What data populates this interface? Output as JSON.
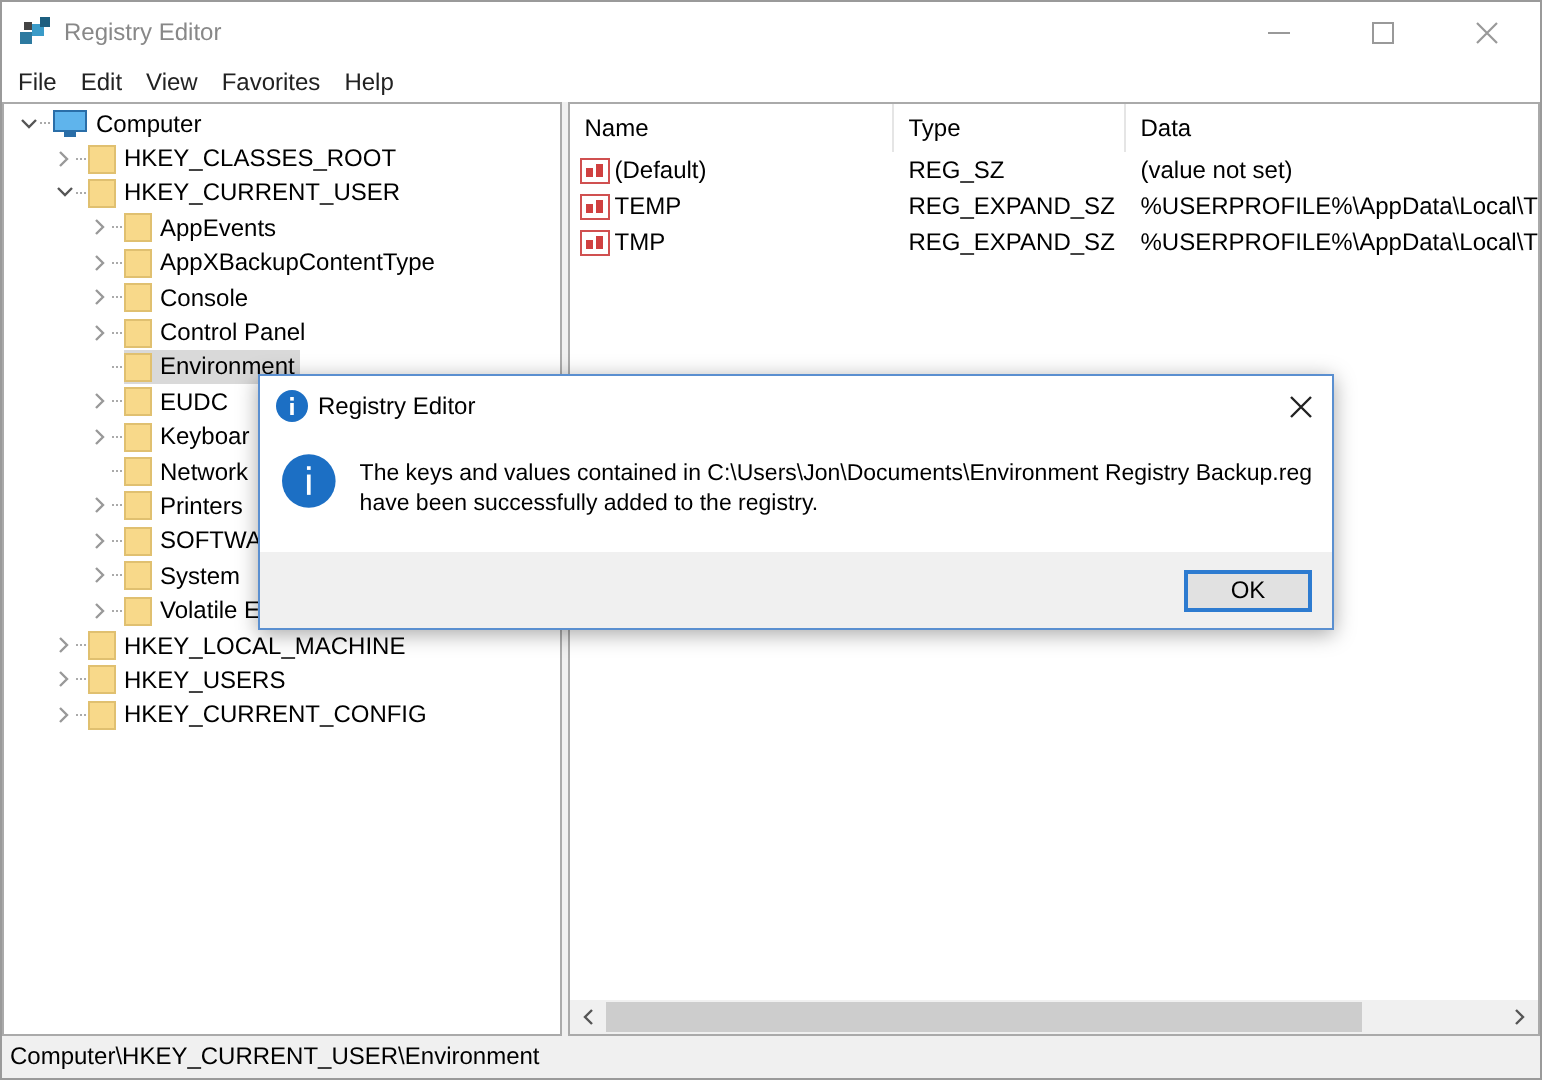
{
  "window": {
    "title": "Registry Editor"
  },
  "menu": [
    "File",
    "Edit",
    "View",
    "Favorites",
    "Help"
  ],
  "tree": {
    "label": "Computer",
    "kind": "branch",
    "expanded": true,
    "selected": false,
    "children": [
      {
        "label": "HKEY_CLASSES_ROOT",
        "kind": "branch",
        "expanded": false,
        "selected": false
      },
      {
        "label": "HKEY_CURRENT_USER",
        "kind": "branch",
        "expanded": true,
        "selected": false,
        "children": [
          {
            "label": "AppEvents",
            "kind": "branch",
            "expanded": false,
            "selected": false
          },
          {
            "label": "AppXBackupContentType",
            "kind": "branch",
            "expanded": false,
            "selected": false
          },
          {
            "label": "Console",
            "kind": "branch",
            "expanded": false,
            "selected": false
          },
          {
            "label": "Control Panel",
            "kind": "branch",
            "expanded": false,
            "selected": false
          },
          {
            "label": "Environment",
            "kind": "leaf",
            "selected": true
          },
          {
            "label": "EUDC",
            "kind": "branch",
            "expanded": false,
            "selected": false
          },
          {
            "label": "Keyboar",
            "kind": "branch",
            "expanded": false,
            "selected": false
          },
          {
            "label": "Network",
            "kind": "leaf",
            "selected": false
          },
          {
            "label": "Printers",
            "kind": "branch",
            "expanded": false,
            "selected": false
          },
          {
            "label": "SOFTWA",
            "kind": "branch",
            "expanded": false,
            "selected": false
          },
          {
            "label": "System",
            "kind": "branch",
            "expanded": false,
            "selected": false
          },
          {
            "label": "Volatile E",
            "kind": "branch",
            "expanded": false,
            "selected": false
          }
        ]
      },
      {
        "label": "HKEY_LOCAL_MACHINE",
        "kind": "branch",
        "expanded": false,
        "selected": false
      },
      {
        "label": "HKEY_USERS",
        "kind": "branch",
        "expanded": false,
        "selected": false
      },
      {
        "label": "HKEY_CURRENT_CONFIG",
        "kind": "branch",
        "expanded": false,
        "selected": false
      }
    ]
  },
  "values": {
    "columns": [
      "Name",
      "Type",
      "Data"
    ],
    "rows": [
      {
        "name": "(Default)",
        "type": "REG_SZ",
        "data": "(value not set)"
      },
      {
        "name": "TEMP",
        "type": "REG_EXPAND_SZ",
        "data": "%USERPROFILE%\\AppData\\Local\\T"
      },
      {
        "name": "TMP",
        "type": "REG_EXPAND_SZ",
        "data": "%USERPROFILE%\\AppData\\Local\\T"
      }
    ]
  },
  "dialog": {
    "title": "Registry Editor",
    "message_lines": [
      "The keys and values contained in C:\\Users\\Jon\\Documents\\Environment Registry Backup.reg",
      "have been successfully added to the registry."
    ],
    "button": "OK"
  },
  "status_bar": "Computer\\HKEY_CURRENT_USER\\Environment"
}
